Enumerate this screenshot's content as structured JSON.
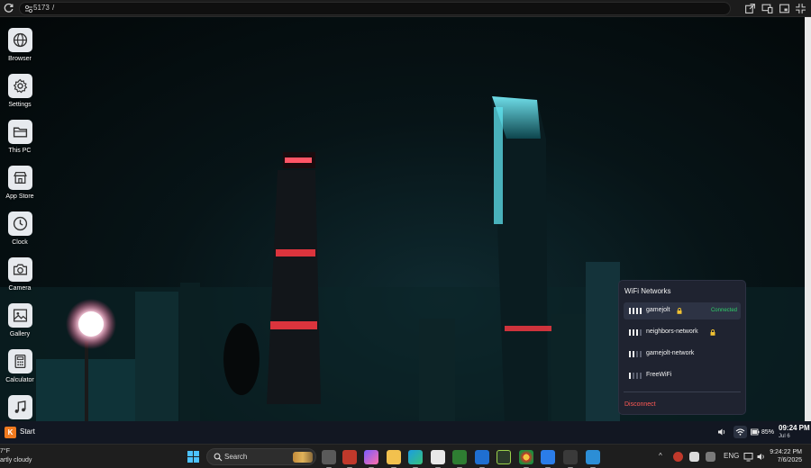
{
  "browser": {
    "url_host": "5173",
    "url_path": "/"
  },
  "desktop": {
    "icons": [
      {
        "label": "Browser",
        "icon": "globe-icon"
      },
      {
        "label": "Settings",
        "icon": "gear-icon"
      },
      {
        "label": "This PC",
        "icon": "folder-icon"
      },
      {
        "label": "App Store",
        "icon": "store-icon"
      },
      {
        "label": "Clock",
        "icon": "clock-icon"
      },
      {
        "label": "Camera",
        "icon": "camera-icon"
      },
      {
        "label": "Gallery",
        "icon": "image-icon"
      },
      {
        "label": "Calculator",
        "icon": "calculator-icon"
      },
      {
        "label": "",
        "icon": "music-icon"
      }
    ]
  },
  "wifi": {
    "title": "WiFi Networks",
    "networks": [
      {
        "name": "gamejolt",
        "locked": true,
        "status": "Connected",
        "strength": 4,
        "active": true
      },
      {
        "name": "neighbors-network",
        "locked": true,
        "status": "",
        "strength": 3,
        "active": false
      },
      {
        "name": "gamejolt-network",
        "locked": false,
        "status": "",
        "strength": 2,
        "active": false
      },
      {
        "name": "FreeWiFi",
        "locked": false,
        "status": "",
        "strength": 1,
        "active": false
      }
    ],
    "disconnect_label": "Disconnect"
  },
  "app_taskbar": {
    "start_logo": "K",
    "start_label": "Start",
    "battery": "85%",
    "time": "09:24 PM",
    "date": "Jul 6"
  },
  "windows_taskbar": {
    "weather_temp": "7°F",
    "weather_desc": "artly cloudy",
    "search_label": "Search",
    "language": "ENG",
    "time": "9:24:22 PM",
    "date": "7/6/2025"
  },
  "colors": {
    "accent_connected": "#2fd06a",
    "disconnect": "#ff5a55",
    "start_logo": "#f07a1f",
    "windows_blue": "#4cc2ff"
  }
}
